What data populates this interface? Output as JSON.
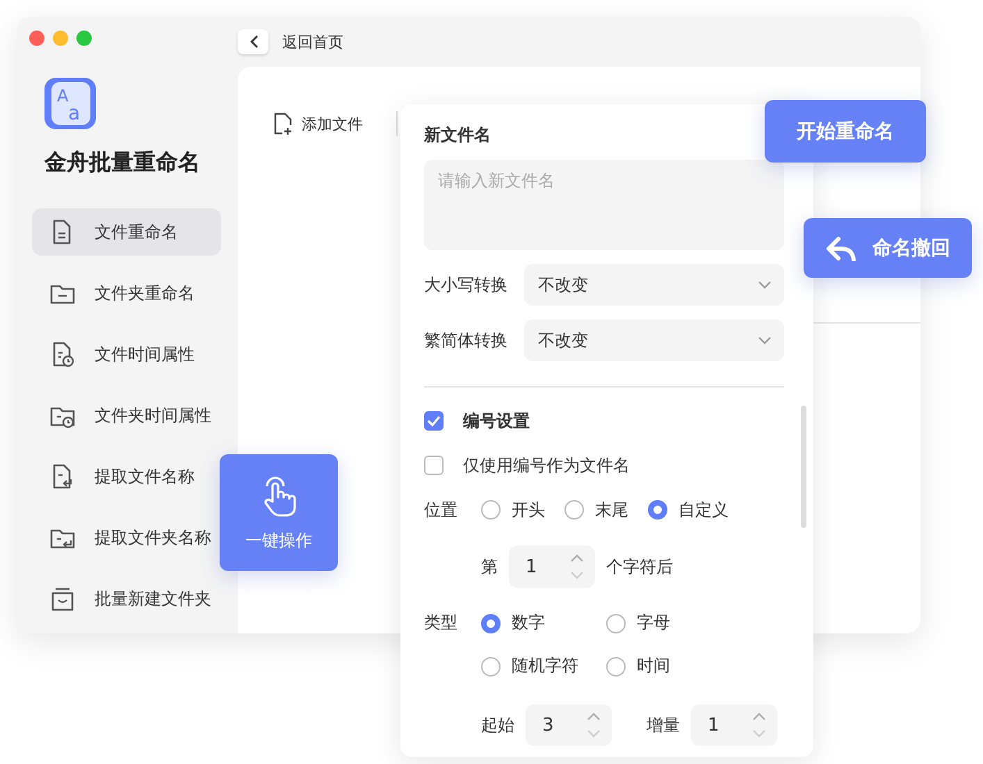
{
  "window": {
    "back_label": "返回首页",
    "logo_letters": [
      "A",
      "a"
    ],
    "app_name": "金舟批量重命名"
  },
  "sidebar": {
    "items": [
      {
        "label": "文件重命名",
        "kind": "file",
        "selected": true
      },
      {
        "label": "文件夹重命名",
        "kind": "folder",
        "selected": false
      },
      {
        "label": "文件时间属性",
        "kind": "file-clock",
        "selected": false
      },
      {
        "label": "文件夹时间属性",
        "kind": "folder-clock",
        "selected": false
      },
      {
        "label": "提取文件名称",
        "kind": "file-extract",
        "selected": false
      },
      {
        "label": "提取文件夹名称",
        "kind": "folder-extract",
        "selected": false
      },
      {
        "label": "批量新建文件夹",
        "kind": "box",
        "selected": false
      }
    ]
  },
  "toolbar": {
    "add_file": "添加文件"
  },
  "panel": {
    "new_name": {
      "label": "新文件名",
      "placeholder": "请输入新文件名"
    },
    "selects": [
      {
        "label": "大小写转换",
        "value": "不改变"
      },
      {
        "label": "繁简体转换",
        "value": "不改变"
      }
    ],
    "checks": [
      {
        "label": "编号设置",
        "checked": true,
        "bold": true
      },
      {
        "label": "仅使用编号作为文件名",
        "checked": false,
        "bold": false
      }
    ],
    "position": {
      "label": "位置",
      "options": [
        {
          "label": "开头",
          "selected": false
        },
        {
          "label": "末尾",
          "selected": false
        },
        {
          "label": "自定义",
          "selected": true
        }
      ]
    },
    "offset": {
      "prefix": "第",
      "value": "1",
      "suffix": "个字符后"
    },
    "type": {
      "label": "类型",
      "options": [
        {
          "label": "数字",
          "selected": true
        },
        {
          "label": "字母",
          "selected": false
        },
        {
          "label": "随机字符",
          "selected": false
        },
        {
          "label": "时间",
          "selected": false
        }
      ]
    },
    "start": {
      "label": "起始",
      "value": "3"
    },
    "step": {
      "label": "增量",
      "value": "1"
    }
  },
  "actions": [
    {
      "label": "开始重命名",
      "kind": "plain"
    },
    {
      "label": "命名撤回",
      "kind": "undo"
    },
    {
      "label": "一键操作",
      "kind": "tap"
    }
  ]
}
